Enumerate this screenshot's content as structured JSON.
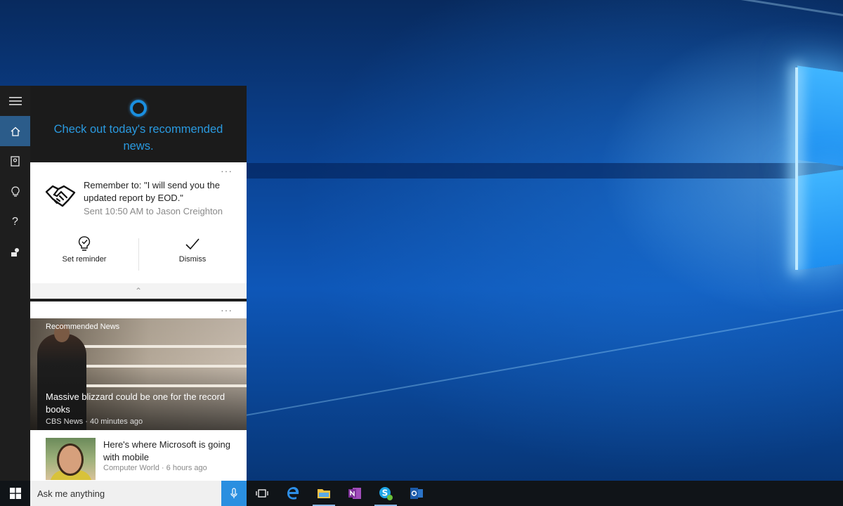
{
  "cortana": {
    "rail": [
      {
        "name": "hamburger-menu-icon"
      },
      {
        "name": "home-icon",
        "active": true
      },
      {
        "name": "notebook-icon"
      },
      {
        "name": "lightbulb-icon"
      },
      {
        "name": "help-icon",
        "glyph": "?"
      },
      {
        "name": "feedback-icon"
      }
    ],
    "header_text": "Check out today's recommended news.",
    "reminder": {
      "text": "Remember to: \"I will send you the updated report by EOD.\"",
      "sent": "Sent 10:50 AM to Jason Creighton",
      "actions": [
        "Set reminder",
        "Dismiss"
      ],
      "more": "···",
      "collapse": "⌃"
    },
    "news": {
      "more": "···",
      "tag": "Recommended News",
      "hero_title": "Massive blizzard could be one for the record books",
      "hero_meta": "CBS News · 40 minutes ago",
      "item_title": "Here's where Microsoft is going with mobile",
      "item_meta": "Computer World · 6 hours ago"
    }
  },
  "taskbar": {
    "search_placeholder": "Ask me anything",
    "apps": [
      "task-view",
      "edge",
      "file-explorer",
      "onenote",
      "skype",
      "outlook"
    ]
  },
  "colors": {
    "accent": "#2a8fe0",
    "rail_active": "#2b5c8a",
    "cortana_blue": "#2a9ae0"
  }
}
